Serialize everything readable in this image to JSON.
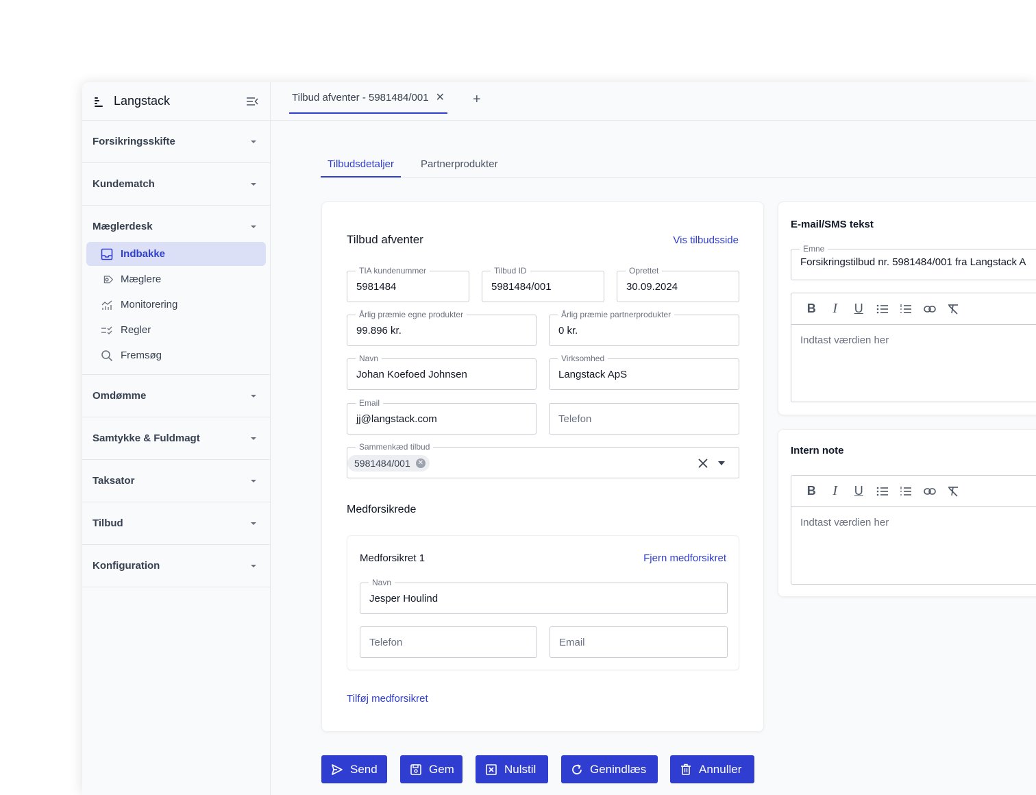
{
  "brand": {
    "name": "Langstack"
  },
  "sidebar": {
    "sections": [
      {
        "label": "Forsikringsskifte"
      },
      {
        "label": "Kundematch"
      },
      {
        "label": "Mæglerdesk",
        "items": [
          {
            "label": "Indbakke",
            "icon": "inbox-icon",
            "active": true
          },
          {
            "label": "Mæglere",
            "icon": "tag-icon"
          },
          {
            "label": "Monitorering",
            "icon": "chart-icon"
          },
          {
            "label": "Regler",
            "icon": "rules-icon"
          },
          {
            "label": "Fremsøg",
            "icon": "search-icon"
          }
        ]
      },
      {
        "label": "Omdømme"
      },
      {
        "label": "Samtykke & Fuldmagt"
      },
      {
        "label": "Taksator"
      },
      {
        "label": "Tilbud"
      },
      {
        "label": "Konfiguration"
      }
    ]
  },
  "tabs": {
    "open_tab": "Tilbud afventer - 5981484/001"
  },
  "subtabs": [
    "Tilbudsdetaljer",
    "Partnerprodukter"
  ],
  "offer": {
    "title": "Tilbud afventer",
    "view_link": "Vis tilbudsside",
    "fields": {
      "tia_label": "TIA kundenummer",
      "tia_value": "5981484",
      "offer_id_label": "Tilbud ID",
      "offer_id_value": "5981484/001",
      "created_label": "Oprettet",
      "created_value": "30.09.2024",
      "own_premium_label": "Årlig præmie egne produkter",
      "own_premium_value": "99.896 kr.",
      "partner_premium_label": "Årlig præmie partnerprodukter",
      "partner_premium_value": "0 kr.",
      "name_label": "Navn",
      "name_value": "Johan Koefoed Johnsen",
      "company_label": "Virksomhed",
      "company_value": "Langstack ApS",
      "email_label": "Email",
      "email_value": "jj@langstack.com",
      "phone_placeholder": "Telefon",
      "link_label": "Sammenkæd tilbud",
      "link_chip": "5981484/001"
    },
    "coinsured": {
      "title": "Medforsikrede",
      "item_title": "Medforsikret 1",
      "remove_link": "Fjern medforsikret",
      "name_label": "Navn",
      "name_value": "Jesper Houlind",
      "phone_placeholder": "Telefon",
      "email_placeholder": "Email",
      "add_link": "Tilføj medforsikret"
    }
  },
  "message": {
    "title": "E-mail/SMS tekst",
    "subject_label": "Emne",
    "subject_value": "Forsikringstilbud nr. 5981484/001 fra Langstack A",
    "placeholder": "Indtast værdien her"
  },
  "note": {
    "title": "Intern note",
    "placeholder": "Indtast værdien her"
  },
  "actions": {
    "send": "Send",
    "save": "Gem",
    "reset": "Nulstil",
    "reload": "Genindlæs",
    "cancel": "Annuller"
  },
  "colors": {
    "accent": "#2f3ed1",
    "active_bg": "#dbe0f7"
  }
}
